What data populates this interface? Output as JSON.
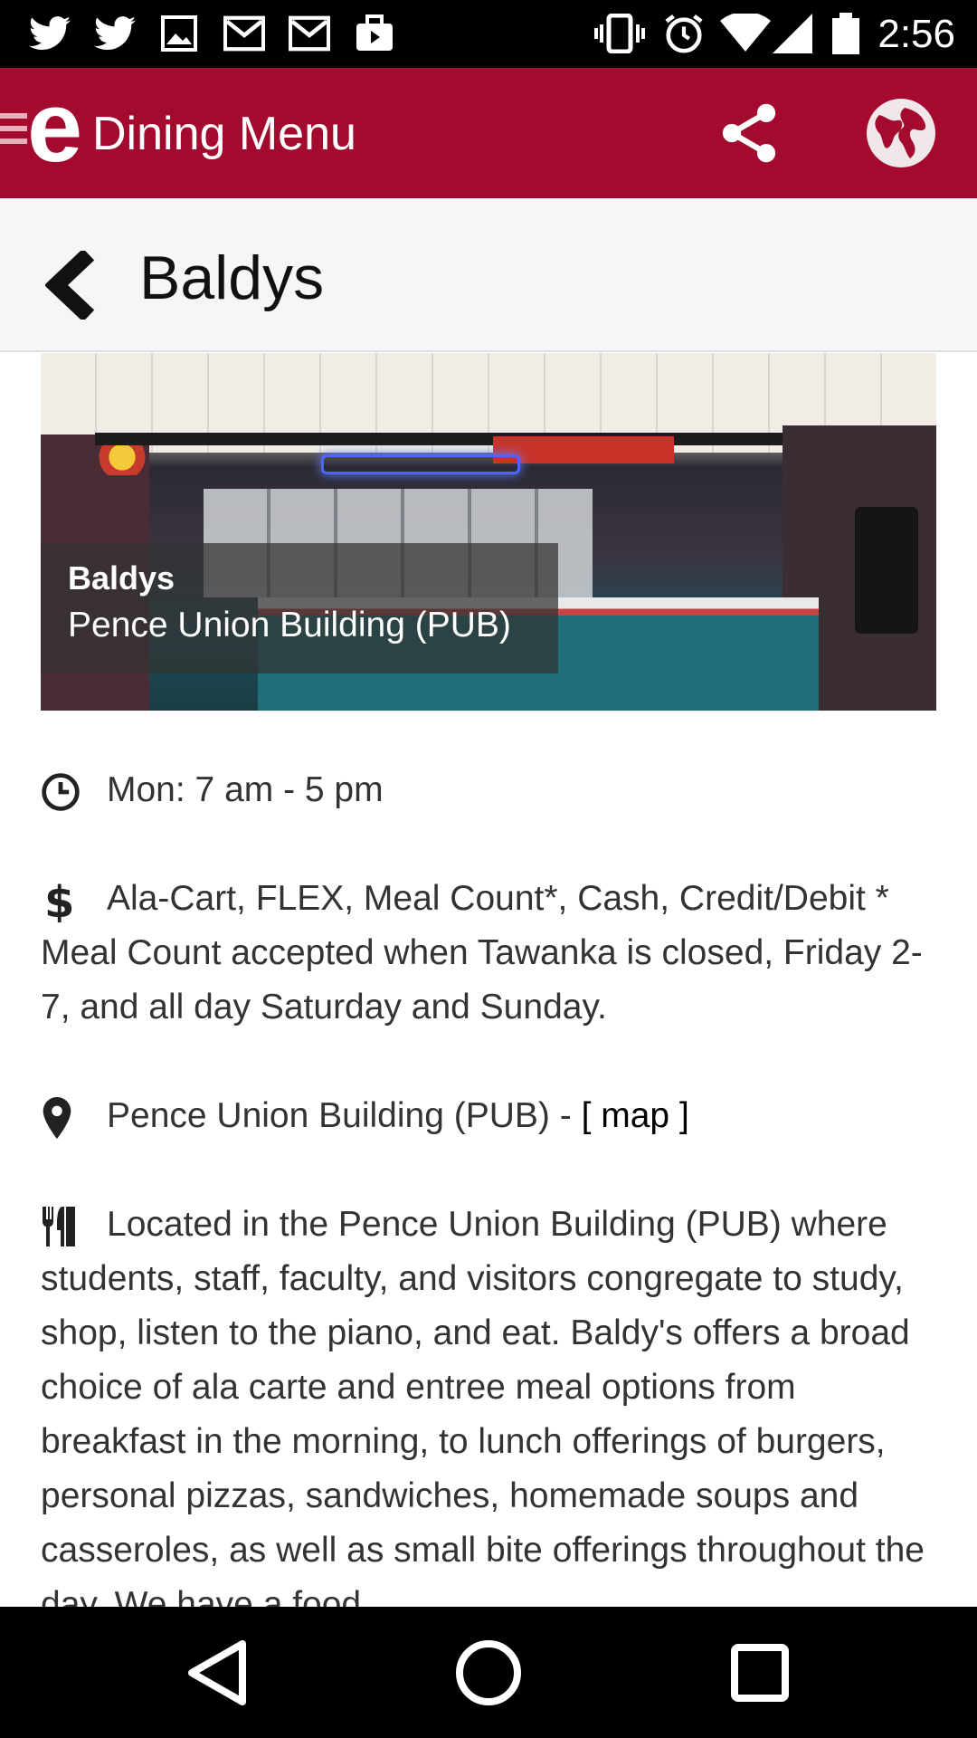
{
  "status_bar": {
    "time": "2:56",
    "icons": [
      "twitter-icon",
      "twitter-icon",
      "image-icon",
      "gmail-icon",
      "gmail-icon",
      "briefcase-play-icon",
      "vibrate-icon",
      "alarm-icon",
      "wifi-icon",
      "signal-icon",
      "battery-icon"
    ]
  },
  "app_bar": {
    "logo": "e",
    "title": "Dining Menu",
    "accent_color": "#a30a2e"
  },
  "page": {
    "title": "Baldys"
  },
  "hero": {
    "name": "Baldys",
    "building": "Pence Union Building (PUB)"
  },
  "details": {
    "hours": "Mon: 7 am - 5 pm",
    "payment": "Ala-Cart, FLEX, Meal Count*, Cash, Credit/Debit * Meal Count accepted when Tawanka is closed, Friday 2-7, and all day Saturday and Sunday.",
    "location": "Pence Union Building (PUB) - ",
    "map_link": "[ map ]",
    "description": "Located in the Pence Union Building (PUB) where students, staff, faculty, and visitors congregate to study, shop, listen to the piano, and eat. Baldy's offers a broad choice of ala carte and entree meal options from breakfast in the morning, to lunch offerings of burgers, personal pizzas, sandwiches, homemade soups and casseroles, as well as small bite offerings throughout the day. We have a food"
  }
}
